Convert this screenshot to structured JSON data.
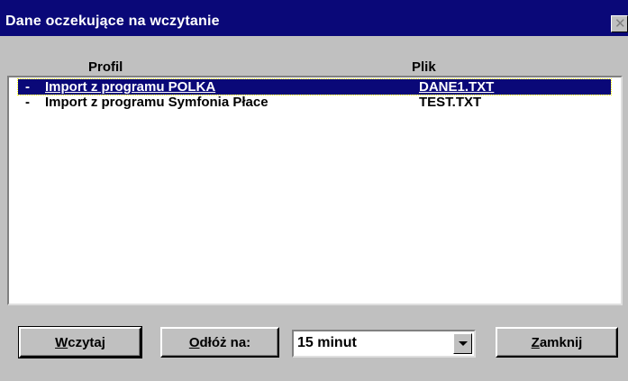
{
  "window": {
    "title": "Dane oczekujące na wczytanie",
    "close_icon": "close-icon"
  },
  "list": {
    "columns": {
      "profil": "Profil",
      "plik": "Plik"
    },
    "rows": [
      {
        "dash": "-",
        "profile": "Import z programu POLKA",
        "file": "DANE1.TXT",
        "selected": true
      },
      {
        "dash": "-",
        "profile": "Import z programu Symfonia Płace",
        "file": "TEST.TXT",
        "selected": false
      }
    ]
  },
  "buttons": {
    "load": {
      "mnemonic": "W",
      "rest": "czytaj"
    },
    "postpone": {
      "mnemonic": "O",
      "rest": "dłóż na:"
    },
    "close": {
      "mnemonic": "Z",
      "rest": "amknij"
    }
  },
  "postpone_select": {
    "value": "15 minut"
  },
  "colors": {
    "titlebar": "#0a0878",
    "selection": "#0a0878",
    "face": "#c0c0c0"
  }
}
